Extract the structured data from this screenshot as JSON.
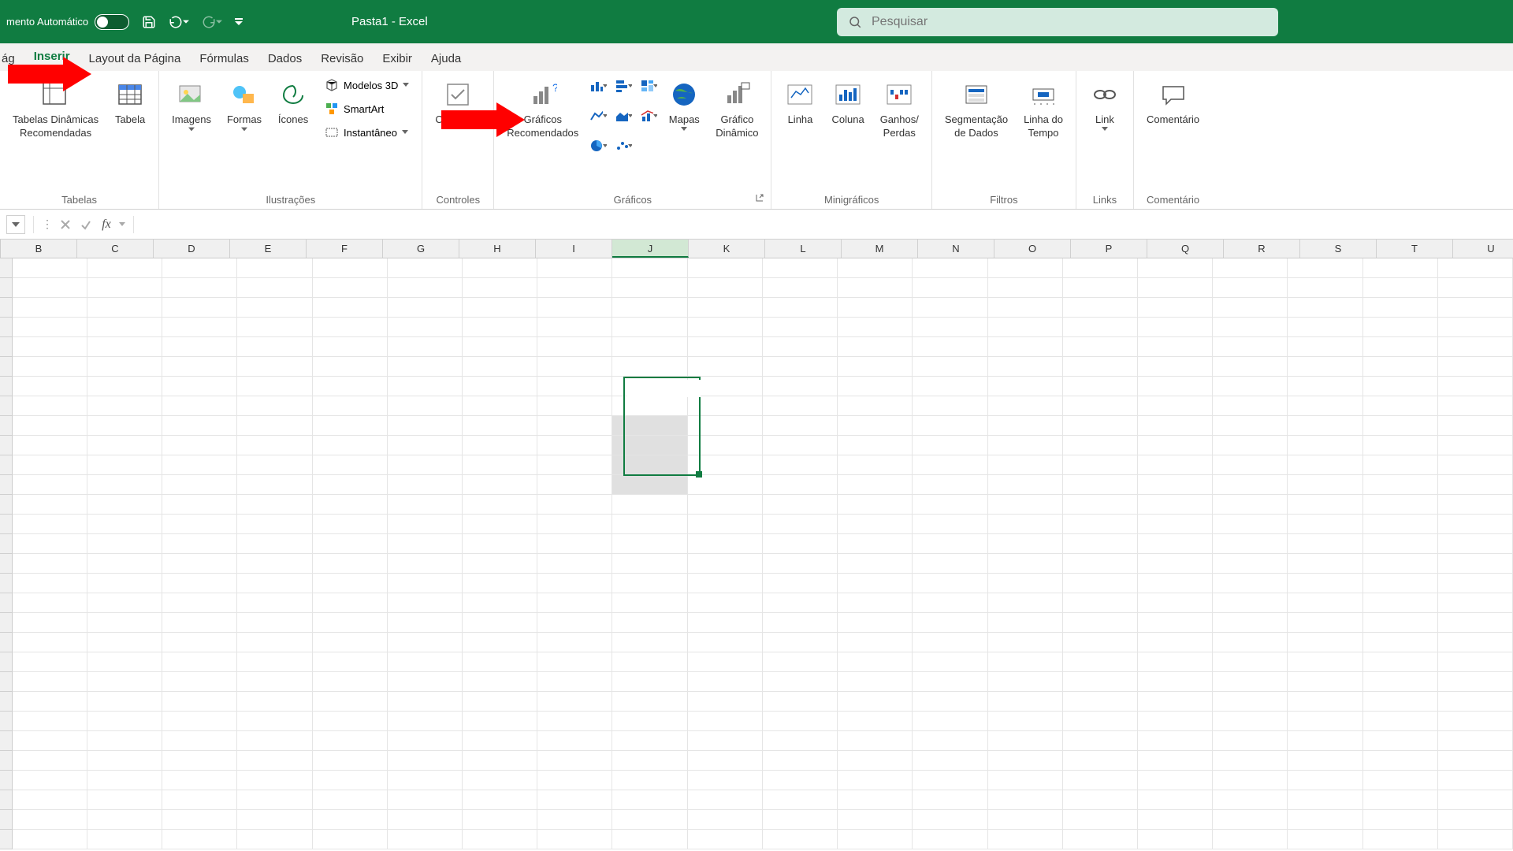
{
  "titlebar": {
    "autosave_label": "mento Automático",
    "filename": "Pasta1 - Excel",
    "search_placeholder": "Pesquisar"
  },
  "tabs": {
    "pagina": "ág",
    "inserir": "Inserir",
    "layout": "Layout da Página",
    "formulas": "Fórmulas",
    "dados": "Dados",
    "revisao": "Revisão",
    "exibir": "Exibir",
    "ajuda": "Ajuda"
  },
  "ribbon": {
    "tabelas": {
      "group": "Tabelas",
      "pivot": "Tabelas Dinâmicas\nRecomendadas",
      "tabela": "Tabela"
    },
    "ilustracoes": {
      "group": "Ilustrações",
      "imagens": "Imagens",
      "formas": "Formas",
      "icones": "Ícones",
      "modelos3d": "Modelos 3D",
      "smartart": "SmartArt",
      "instantaneo": "Instantâneo"
    },
    "controles": {
      "group": "Controles",
      "checkbox": "Checkbox"
    },
    "graficos": {
      "group": "Gráficos",
      "recomendados": "Gráficos\nRecomendados",
      "mapas": "Mapas",
      "dinamico": "Gráfico\nDinâmico"
    },
    "minigraficos": {
      "group": "Minigráficos",
      "linha": "Linha",
      "coluna": "Coluna",
      "ganhos": "Ganhos/\nPerdas"
    },
    "filtros": {
      "group": "Filtros",
      "segmentacao": "Segmentação\nde Dados",
      "linhatempo": "Linha do\nTempo"
    },
    "links": {
      "group": "Links",
      "link": "Link"
    },
    "comentarios": {
      "group": "Comentário",
      "comentario": "Comentário"
    }
  },
  "columns": [
    "B",
    "C",
    "D",
    "E",
    "F",
    "G",
    "H",
    "I",
    "J",
    "K",
    "L",
    "M",
    "N",
    "O",
    "P",
    "Q",
    "R",
    "S",
    "T",
    "U"
  ],
  "selected_column": "J",
  "col_widths": {
    "default": 97,
    "narrow": 97
  }
}
